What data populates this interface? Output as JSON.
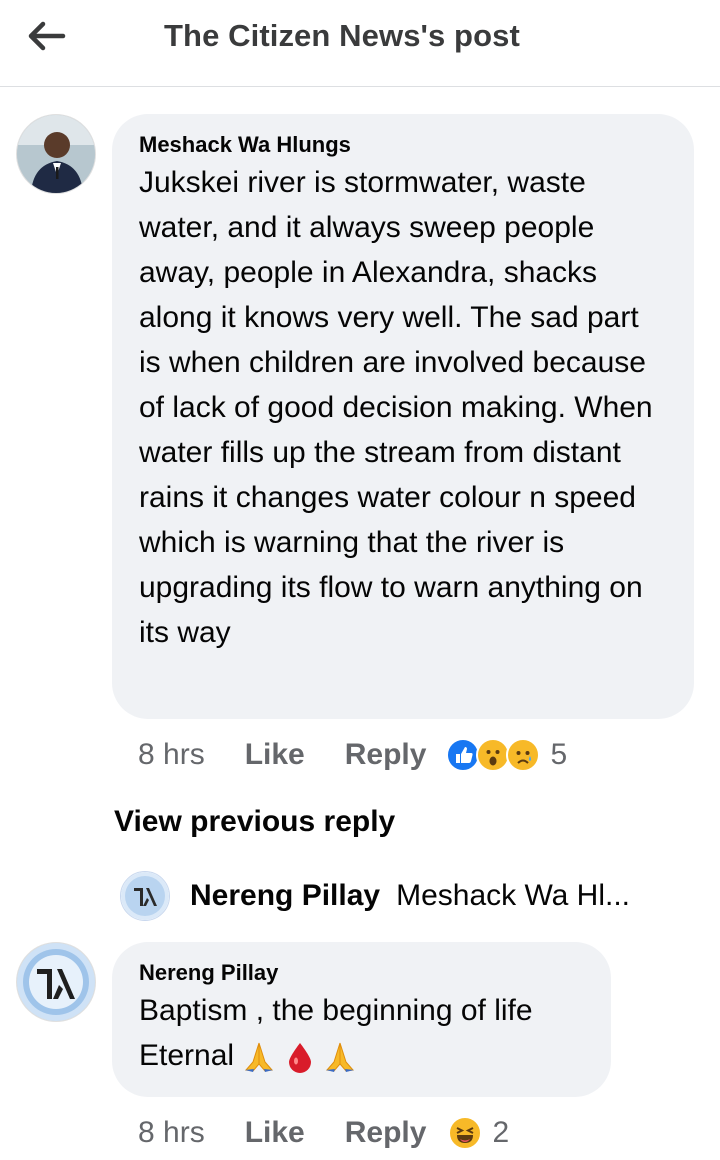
{
  "header": {
    "title": "The Citizen News's post"
  },
  "comments": [
    {
      "author": "Meshack Wa Hlungs",
      "text": "Jukskei river is stormwater, waste water, and it always sweep people away, people in Alexandra, shacks along it knows very well. The sad part is when children are involved because of lack of good decision making. When water fills up the stream from distant rains it changes water colour n speed which is warning that the river is upgrading its flow to warn anything on its way",
      "time": "8 hrs",
      "like_label": "Like",
      "reply_label": "Reply",
      "reactions": [
        "like-icon",
        "wow-icon",
        "sad-icon"
      ],
      "reaction_count": "5"
    },
    {
      "author": "Nereng Pillay",
      "text_prefix": "Baptism , the beginning of life",
      "text_second_line": "Eternal",
      "text_emojis": [
        "folded-hands-icon",
        "blood-drop-icon",
        "folded-hands-icon"
      ],
      "time": "8 hrs",
      "like_label": "Like",
      "reply_label": "Reply",
      "reactions": [
        "haha-icon"
      ],
      "reaction_count": "2"
    }
  ],
  "thread": {
    "view_previous_label": "View previous reply",
    "preview_name": "Nereng Pillay",
    "preview_snippet": "Meshack Wa Hl..."
  },
  "colors": {
    "bubble": "#f0f2f5",
    "secondary_text": "#65676b",
    "like_blue": "#1877f2",
    "reaction_yellow": "#f7b928"
  }
}
